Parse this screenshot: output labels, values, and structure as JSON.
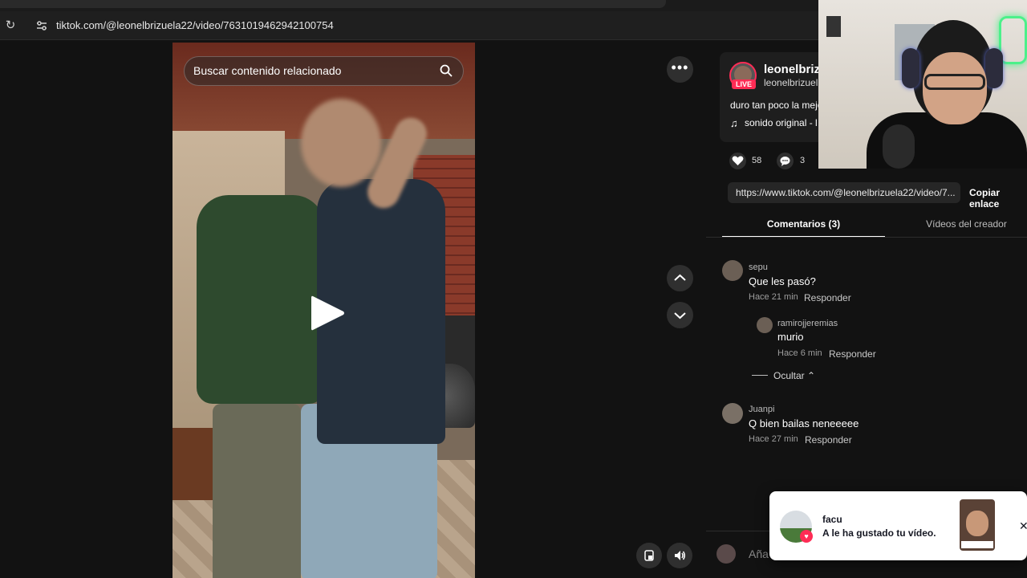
{
  "browser": {
    "url": "tiktok.com/@leonelbrizuela22/video/7631019462942100754"
  },
  "video": {
    "search_placeholder": "Buscar contenido relacionado"
  },
  "controls": {
    "more_label": "•••"
  },
  "creator": {
    "name": "leonelbriz",
    "handle": "leonelbrizuel",
    "live_badge": "LIVE",
    "description": "duro tan poco la mejo",
    "music": "sonido original - l",
    "music_icon": "♫"
  },
  "stats": {
    "likes": "58",
    "comments": "3"
  },
  "share": {
    "link": "https://www.tiktok.com/@leonelbrizuela22/video/7...",
    "copy_label": "Copiar enlace"
  },
  "tabs": {
    "comments": "Comentarios (3)",
    "creator_videos": "Vídeos del creador"
  },
  "comments": [
    {
      "user": "sepu",
      "text": "Que les pasó?",
      "time": "Hace 21 min",
      "reply": "Responder"
    },
    {
      "user": "ramirojjeremias",
      "text": "murio",
      "time": "Hace 6 min",
      "reply": "Responder"
    },
    {
      "user": "Juanpi",
      "text": "Q bien bailas neneeeee",
      "time": "Hace 27 min",
      "reply": "Responder"
    }
  ],
  "replies_toggle": "Ocultar",
  "add_comment_placeholder": "Aña",
  "notification": {
    "user": "facu",
    "text": "A le ha gustado tu vídeo.",
    "close": "✕"
  },
  "colors": {
    "accent": "#fe2c55",
    "background": "#121212"
  }
}
